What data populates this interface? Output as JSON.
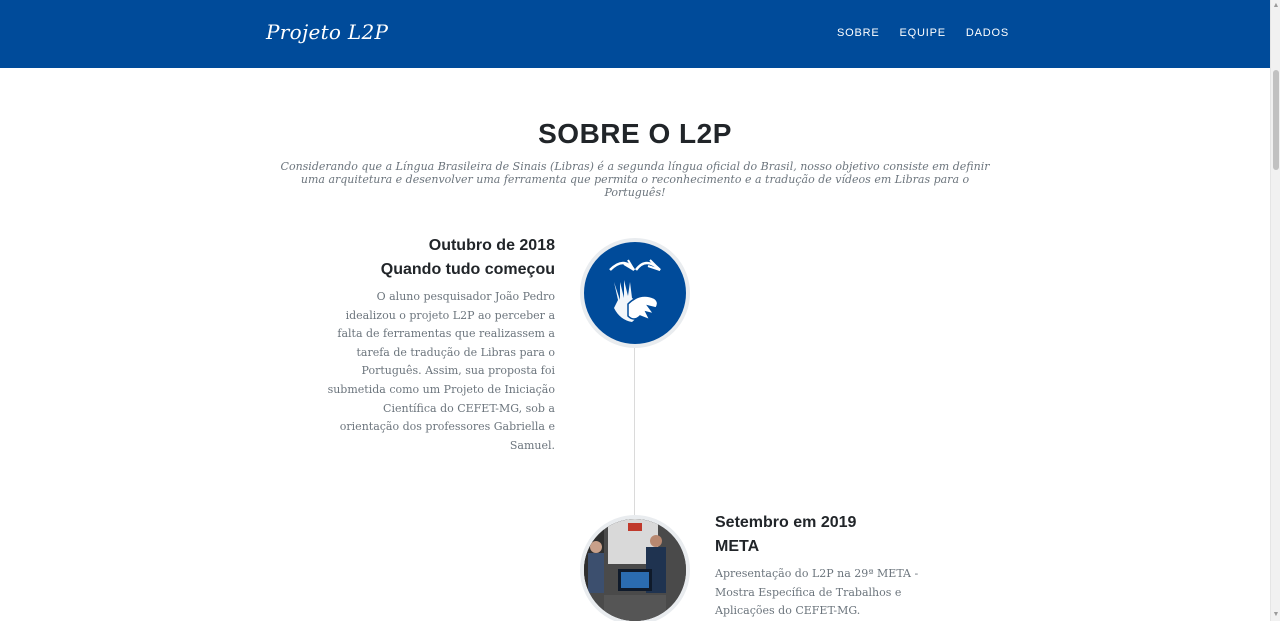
{
  "navbar": {
    "brand": "Projeto L2P",
    "links": [
      "SOBRE",
      "EQUIPE",
      "DADOS"
    ],
    "background_color": "#004b9a"
  },
  "about": {
    "title": "SOBRE O L2P",
    "subtitle": "Considerando que a Língua Brasileira de Sinais (Libras) é a segunda língua oficial do Brasil, nosso objetivo consiste em definir uma arquitetura e desenvolver uma ferramenta que permita o reconhecimento e a tradução de vídeos em Libras para o Português!"
  },
  "timeline": [
    {
      "date": "Outubro de 2018",
      "heading": "Quando tudo começou",
      "text": "O aluno pesquisador João Pedro idealizou o projeto L2P ao perceber a falta de ferramentas que realizassem a tarefa de tradução de Libras para o Português. Assim, sua proposta foi submetida como um Projeto de Iniciação Científica do CEFET-MG, sob a orientação dos professores Gabriella e Samuel.",
      "image": "sign-language-icon"
    },
    {
      "date": "Setembro em 2019",
      "heading": "META",
      "text": "Apresentação do L2P na 29ª META - Mostra Específica de Trabalhos e Aplicações do CEFET-MG.",
      "image": "event-photo"
    }
  ]
}
